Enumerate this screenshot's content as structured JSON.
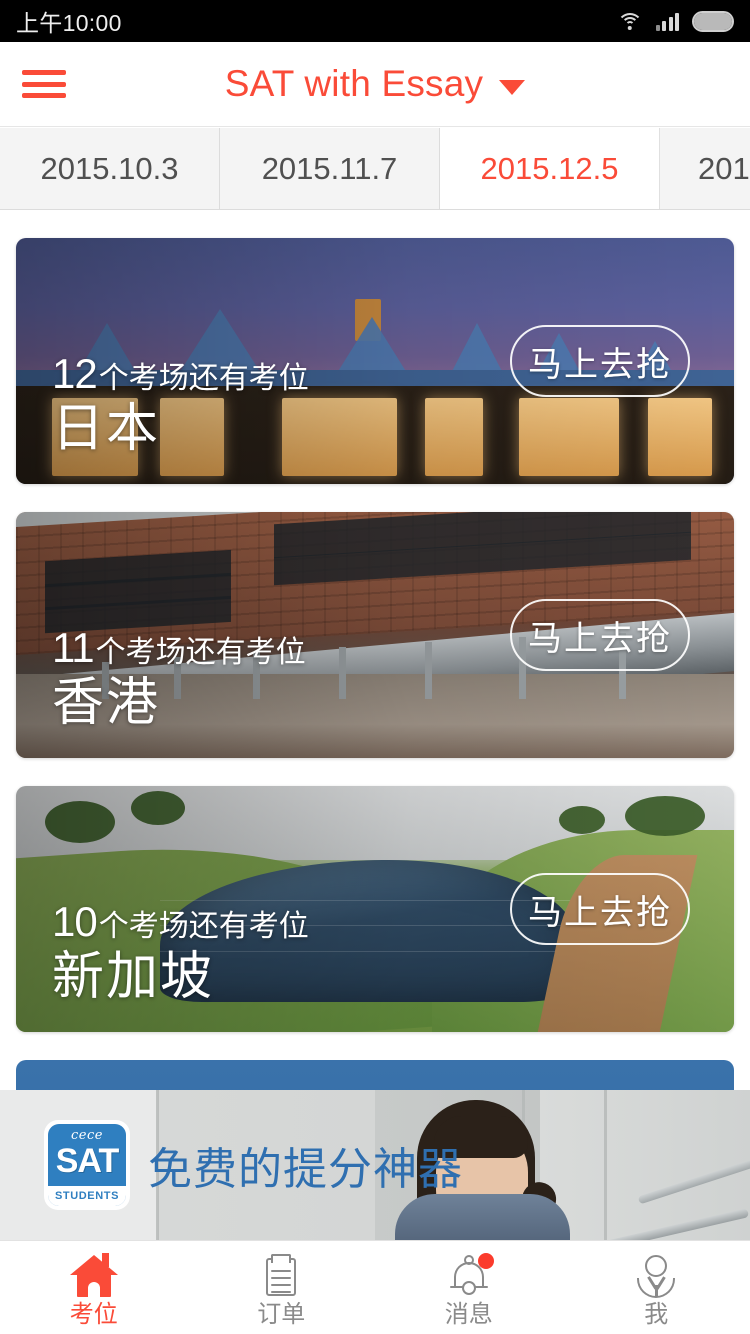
{
  "status_bar": {
    "time": "上午10:00",
    "wifi_icon": "wifi-icon",
    "signal_icon": "signal-bars-icon",
    "battery_icon": "battery-icon"
  },
  "header": {
    "menu_icon": "hamburger-menu-icon",
    "title": "SAT with Essay",
    "dropdown_icon": "chevron-down-icon",
    "accent_color": "#fa4b38"
  },
  "date_tabs": {
    "items": [
      {
        "label": "2015.10.3",
        "active": false
      },
      {
        "label": "2015.11.7",
        "active": false
      },
      {
        "label": "2015.12.5",
        "active": true
      },
      {
        "label": "201",
        "active": false
      }
    ]
  },
  "cards": [
    {
      "seat_count": "12",
      "seat_suffix": "个考场还有考位",
      "city": "日本",
      "button_label": "马上去抢",
      "photo": "japan-dusk-building-photo"
    },
    {
      "seat_count": "11",
      "seat_suffix": "个考场还有考位",
      "city": "香港",
      "button_label": "马上去抢",
      "photo": "hongkong-brick-campus-photo"
    },
    {
      "seat_count": "10",
      "seat_suffix": "个考场还有考位",
      "city": "新加坡",
      "button_label": "马上去抢",
      "photo": "singapore-green-roof-photo"
    }
  ],
  "promo_banner": {
    "logo": {
      "script_text": "cece",
      "main_text": "SAT",
      "sub_text": "STUDENTS"
    },
    "text": "免费的提分神器",
    "text_color": "#2f6fb0",
    "photo": "student-girl-photo"
  },
  "tab_bar": {
    "items": [
      {
        "label": "考位",
        "icon": "home-icon",
        "active": true,
        "badge": false
      },
      {
        "label": "订单",
        "icon": "clipboard-icon",
        "active": false,
        "badge": false
      },
      {
        "label": "消息",
        "icon": "bell-icon",
        "active": false,
        "badge": true
      },
      {
        "label": "我",
        "icon": "person-icon",
        "active": false,
        "badge": false
      }
    ]
  }
}
